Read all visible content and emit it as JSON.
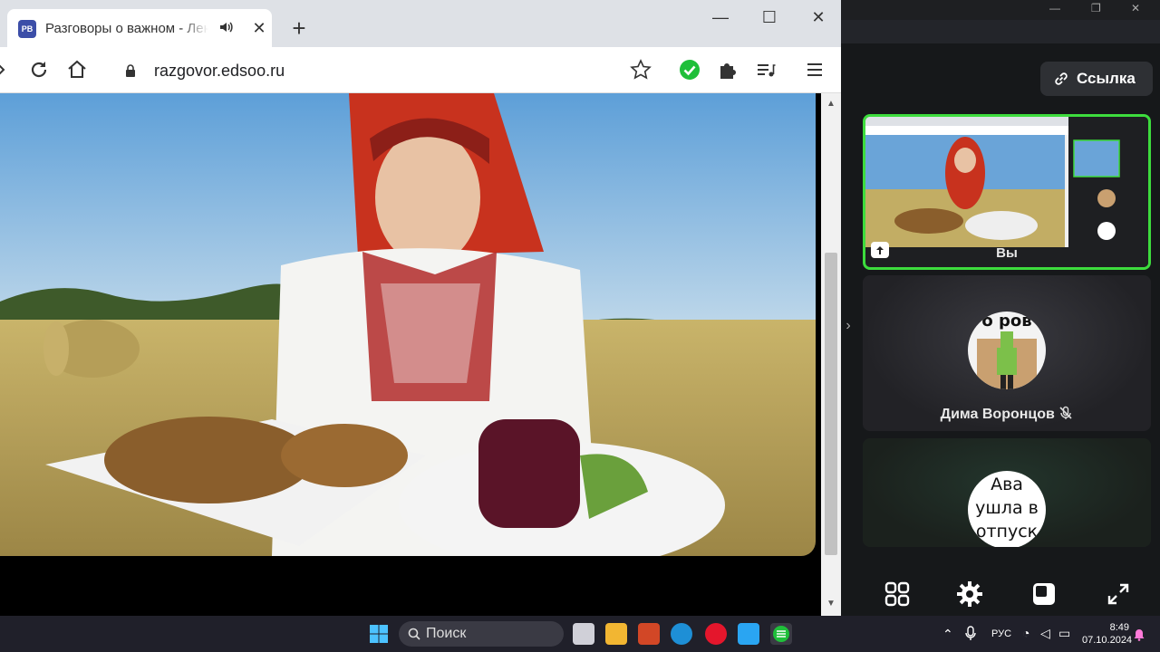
{
  "browser": {
    "tab": {
      "favicon_text": "PB",
      "title": "Разговоры о важном - Лента"
    },
    "url": "razgovor.edsoo.ru"
  },
  "sidebar": {
    "link_button": "Ссылка",
    "tiles": [
      {
        "label": "Вы",
        "highlighted": true
      },
      {
        "name": "Дима Воронцов",
        "muted": true,
        "avatar_text": "о ров"
      },
      {
        "avatar_text": "Ава ушла в отпуск"
      }
    ],
    "controls": [
      "grid-icon",
      "settings-icon",
      "layout-icon",
      "fullscreen-icon"
    ]
  },
  "taskbar": {
    "search_label": "Поиск",
    "language": "РУС",
    "time": "8:49",
    "date": "07.10.2024"
  },
  "colors": {
    "tile_highlight": "#3ddc3d",
    "taskbar_bg": "#20202a"
  }
}
